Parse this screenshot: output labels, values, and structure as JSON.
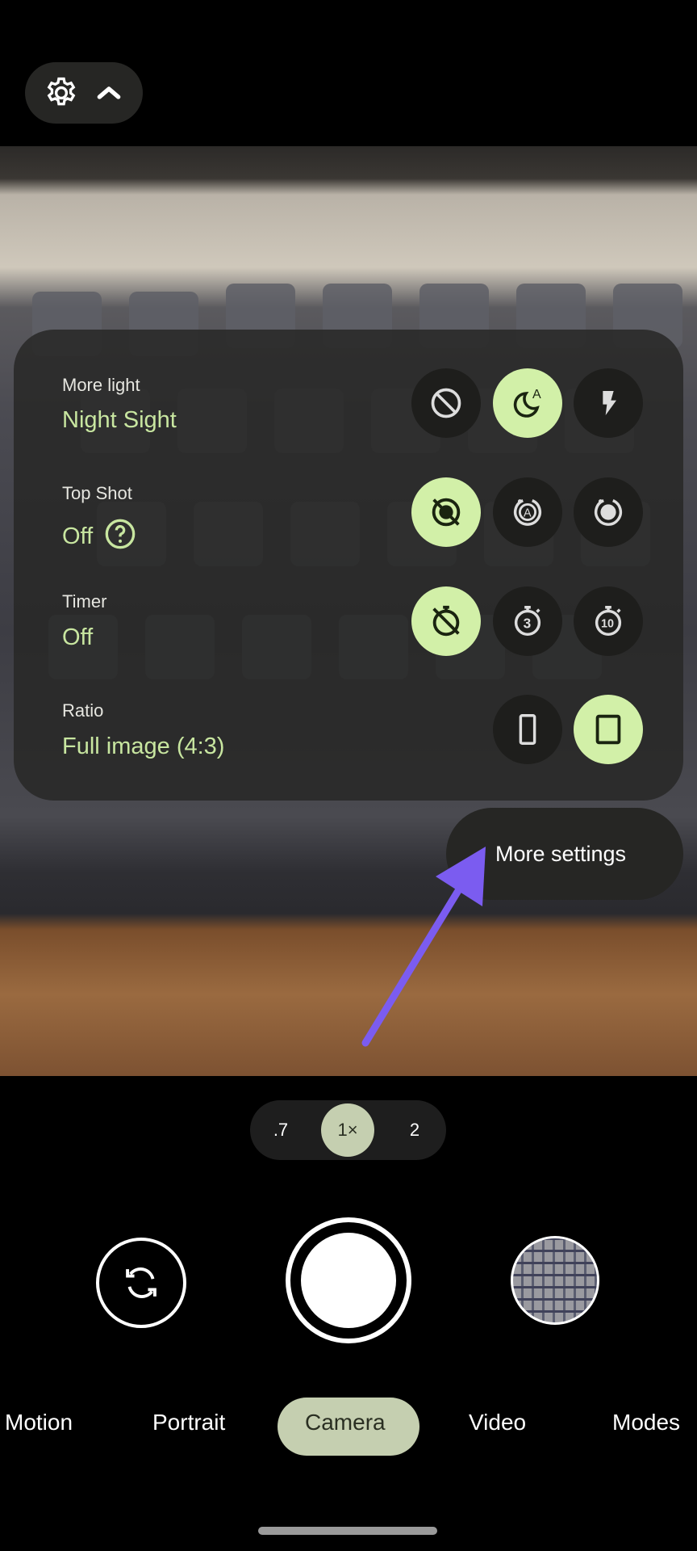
{
  "top_bar": {
    "icons": [
      "gear-icon",
      "chevron-up-icon"
    ]
  },
  "settings": {
    "rows": [
      {
        "label": "More light",
        "value": "Night Sight",
        "options": [
          "off-icon",
          "night-sight-auto-icon",
          "flash-icon"
        ],
        "selected": 1
      },
      {
        "label": "Top Shot",
        "value": "Off",
        "help_icon": "help-circle-icon",
        "options": [
          "top-shot-off-icon",
          "top-shot-auto-icon",
          "top-shot-on-icon"
        ],
        "selected": 0
      },
      {
        "label": "Timer",
        "value": "Off",
        "options": [
          "timer-off-icon",
          "timer-3s-icon",
          "timer-10s-icon"
        ],
        "selected": 0
      },
      {
        "label": "Ratio",
        "value": "Full image (4:3)",
        "options": [
          "ratio-16-9-icon",
          "ratio-4-3-icon"
        ],
        "selected": 1
      }
    ],
    "more_settings": "More settings"
  },
  "zoom": {
    "options": [
      ".7",
      "1×",
      "2"
    ],
    "selected": 1
  },
  "modes": {
    "items": [
      "Motion",
      "Portrait",
      "Camera",
      "Video",
      "Modes"
    ],
    "selected": 2
  },
  "colors": {
    "accent": "#d2f0a8",
    "accent_text": "#c8e6a0",
    "arrow": "#7b5cf0",
    "mode_selected": "#c5cfb0"
  }
}
